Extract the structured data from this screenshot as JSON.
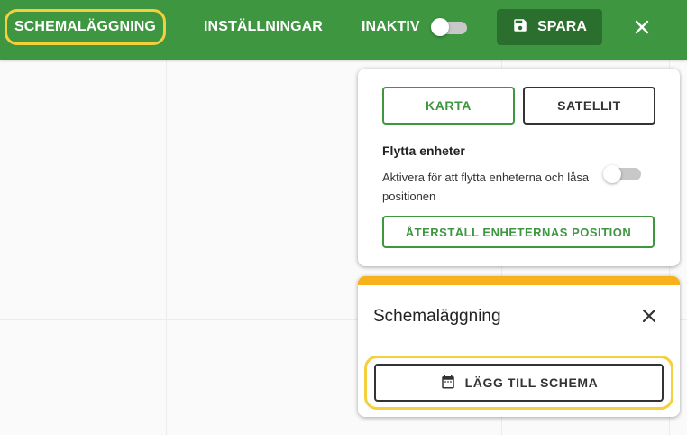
{
  "topbar": {
    "tab_schedule": "SCHEMALÄGGNING",
    "tab_settings": "INSTÄLLNINGAR",
    "inactive_label": "INAKTIV",
    "inactive_toggle_on": false,
    "save_label": "SPARA",
    "save_icon": "floppy-disk-icon",
    "close_icon": "close-icon"
  },
  "map_options": {
    "karta_label": "KARTA",
    "satellite_label": "SATELLIT",
    "move_units_title": "Flytta enheter",
    "move_units_description": "Aktivera för att flytta enheterna och låsa positionen",
    "move_units_toggle_on": false,
    "reset_label": "ÅTERSTÄLL ENHETERNAS POSITION"
  },
  "schedule_panel": {
    "title": "Schemaläggning",
    "close_icon": "close-icon",
    "add_label": "LÄGG TILL SCHEMA",
    "add_icon": "calendar-icon"
  },
  "colors": {
    "topbar_green": "#3e9640",
    "save_button_dark_green": "#2a6f2d",
    "highlight_yellow": "#f5cf3c",
    "schedule_accent_orange": "#f7b21b"
  }
}
